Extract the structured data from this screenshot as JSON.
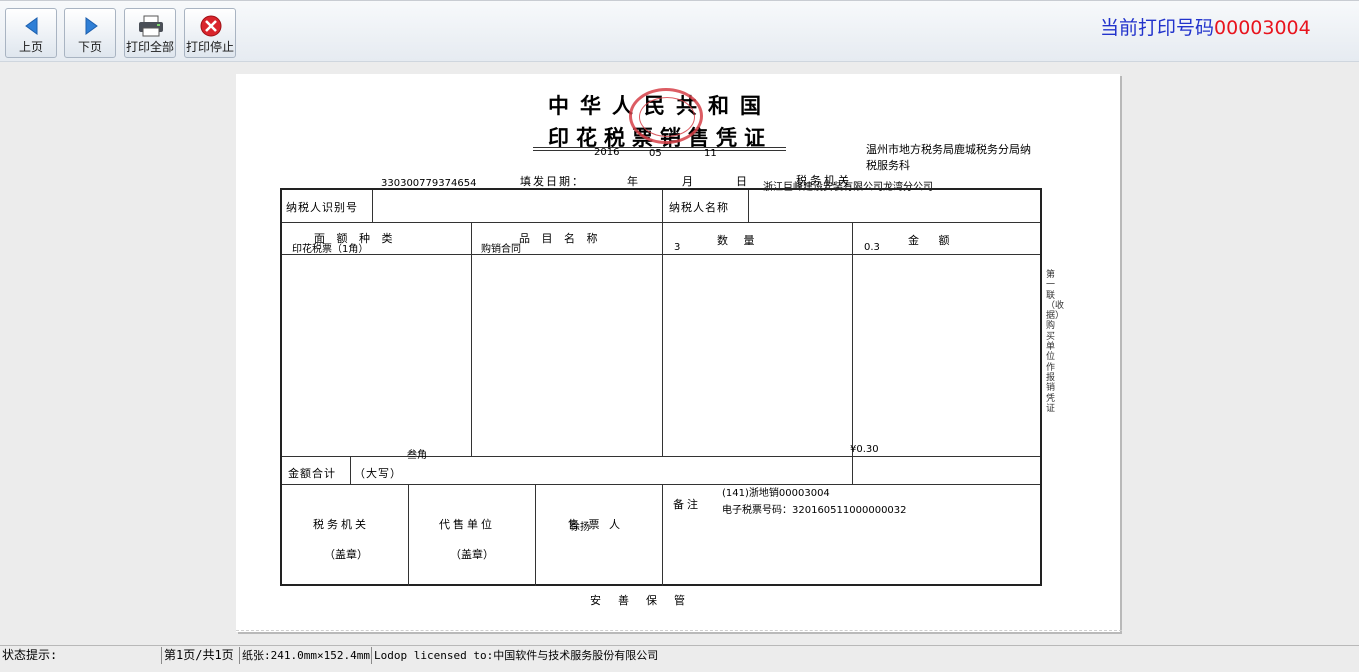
{
  "toolbar": {
    "prev_label": "上页",
    "next_label": "下页",
    "print_all_label": "打印全部",
    "print_stop_label": "打印停止",
    "print_code_label": "当前打印号码",
    "print_code_value": "00003004"
  },
  "voucher": {
    "title_line1": "中华人民共和国",
    "title_line2": "印花税票销售凭证",
    "date_year": "2016",
    "date_month": "05",
    "date_day": "11",
    "issue_date_label": "填发日期：",
    "year_label": "年",
    "month_label": "月",
    "day_label": "日",
    "tax_authority_label": "税务机关",
    "tax_authority_line1": "温州市地方税务局鹿城税务分局纳",
    "tax_authority_line2": "税服务科",
    "taxpayer_id": "330300779374654",
    "taxpayer_name": "浙江巨峰建设安装有限公司龙湾分公司",
    "taxpayer_id_label": "纳税人识别号",
    "taxpayer_name_label": "纳税人名称",
    "col_face_type": "面 额 种 类",
    "col_item_name": "品 目 名 称",
    "col_quantity": "数   量",
    "col_amount": "金   额",
    "row_face_type": "印花税票（1角）",
    "row_item_name": "购销合同",
    "row_quantity": "3",
    "row_amount": "0.3",
    "amount_in_words": "叁角",
    "amount_total": "¥0.30",
    "total_label": "金额合计",
    "capital_label": "（大写）",
    "sig_tax_office": "税务机关",
    "sig_agent": "代售单位",
    "sig_seller_label": "售 票 人",
    "sig_seller_name": "徐扬",
    "stamp_note": "（盖章）",
    "remark_label": "备注",
    "remark_line1": "(141)浙地销00003004",
    "remark_line2": "电子税票号码：320160511000000032",
    "footer_text": "安善保管",
    "side_text": "第一联（收据）购买单位作报销凭证"
  },
  "statusbar": {
    "hint_label": "状态提示:",
    "page_info": "第1页/共1页",
    "paper_info": "纸张:241.0mm×152.4mm",
    "license_info": "Lodop licensed to:中国软件与技术服务股份有限公司"
  },
  "colors": {
    "print_code_label": "#2233cc",
    "print_code_value": "#e8141e",
    "seal": "#d64048"
  }
}
